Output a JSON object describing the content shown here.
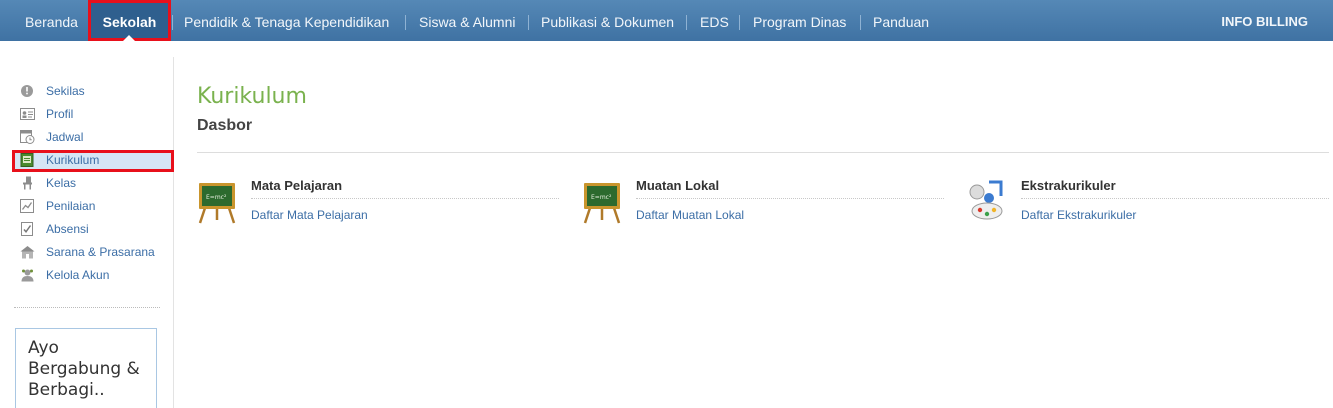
{
  "nav": {
    "items": [
      "Beranda",
      "Sekolah",
      "Pendidik & Tenaga Kependidikan",
      "Siswa & Alumni",
      "Publikasi & Dokumen",
      "EDS",
      "Program Dinas",
      "Panduan"
    ],
    "billing": "INFO BILLING"
  },
  "sidebar": {
    "items": [
      {
        "label": "Sekilas",
        "icon": "info-icon"
      },
      {
        "label": "Profil",
        "icon": "id-card-icon"
      },
      {
        "label": "Jadwal",
        "icon": "calendar-clock-icon"
      },
      {
        "label": "Kurikulum",
        "icon": "book-icon"
      },
      {
        "label": "Kelas",
        "icon": "chair-icon"
      },
      {
        "label": "Penilaian",
        "icon": "chart-icon"
      },
      {
        "label": "Absensi",
        "icon": "checklist-icon"
      },
      {
        "label": "Sarana & Prasarana",
        "icon": "building-icon"
      },
      {
        "label": "Kelola Akun",
        "icon": "user-gear-icon"
      }
    ],
    "promo": "Ayo Bergabung & Berbagi.."
  },
  "main": {
    "title": "Kurikulum",
    "subtitle": "Dasbor",
    "cards": [
      {
        "title": "Mata Pelajaran",
        "link": "Daftar Mata Pelajaran",
        "icon": "chalkboard-icon"
      },
      {
        "title": "Muatan Lokal",
        "link": "Daftar Muatan Lokal",
        "icon": "chalkboard-icon"
      },
      {
        "title": "Ekstrakurikuler",
        "link": "Daftar Ekstrakurikuler",
        "icon": "activities-icon"
      }
    ]
  },
  "colors": {
    "nav_bg": "#4a7db0",
    "accent_red": "#e8101b",
    "title_green": "#7ab24e",
    "link_blue": "#3c6ea6"
  }
}
